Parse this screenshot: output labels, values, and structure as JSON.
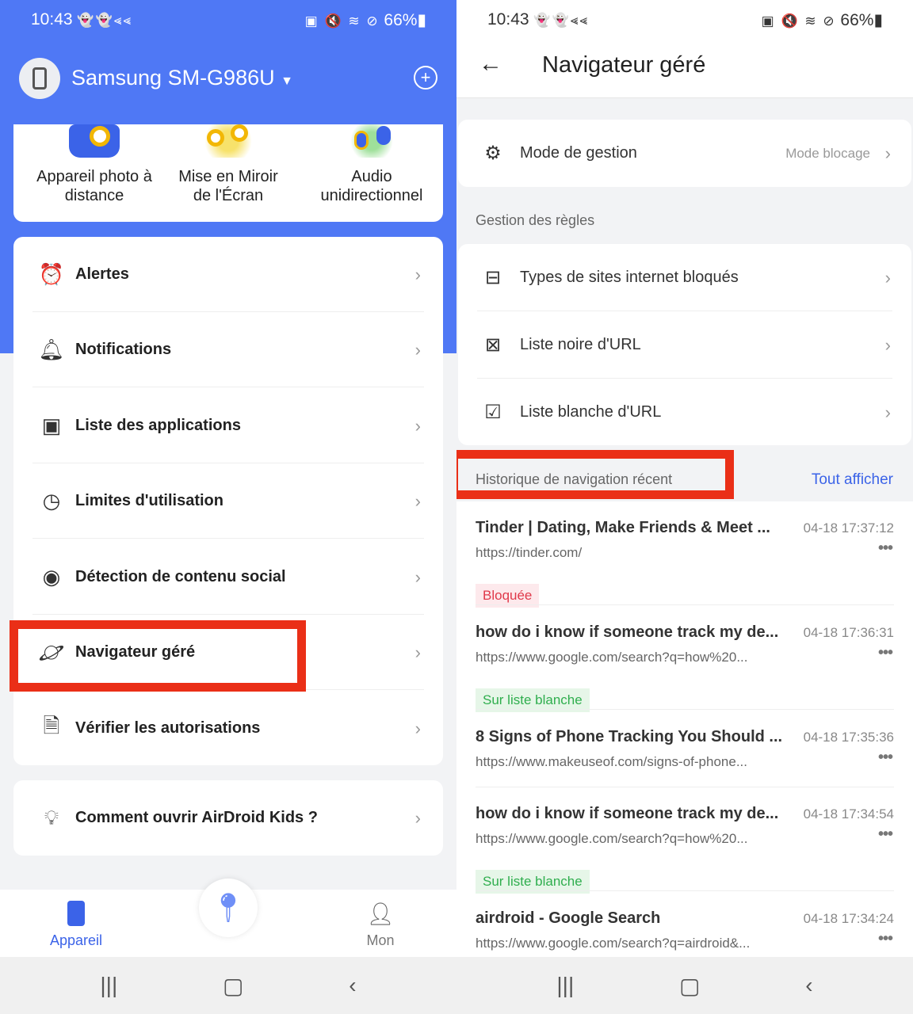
{
  "colors": {
    "brand": "#4f78f5",
    "highlight": "#ea2f17",
    "blocked": "#e0394a",
    "whitelisted": "#2fae4e"
  },
  "status": {
    "time": "10:43",
    "battery": "66%",
    "left_icons": "👻👻⪡⪡",
    "right_icons": "▣ 🔇 ≋ ⊘"
  },
  "left": {
    "device_name": "Samsung SM-G986U",
    "features": [
      {
        "label": "Appareil photo à distance",
        "icon": "camera-icon"
      },
      {
        "label": "Mise en Miroir de l'Écran",
        "icon": "binoculars-icon"
      },
      {
        "label": "Audio unidirectionnel",
        "icon": "headphones-icon"
      }
    ],
    "menu": [
      {
        "label": "Alertes",
        "icon": "alarm-icon"
      },
      {
        "label": "Notifications",
        "icon": "bell-icon"
      },
      {
        "label": "Liste des applications",
        "icon": "apps-grid-icon"
      },
      {
        "label": "Limites d'utilisation",
        "icon": "clock-icon"
      },
      {
        "label": "Détection de contenu social",
        "icon": "eye-icon"
      },
      {
        "label": "Navigateur géré",
        "icon": "planet-icon"
      },
      {
        "label": "Vérifier les autorisations",
        "icon": "doc-search-icon"
      }
    ],
    "help": "Comment ouvrir AirDroid Kids ?",
    "nav": {
      "device": "Appareil",
      "me": "Mon"
    }
  },
  "right": {
    "title": "Navigateur géré",
    "mode_label": "Mode de gestion",
    "mode_value": "Mode blocage",
    "rules_header": "Gestion des règles",
    "rules": [
      {
        "label": "Types de sites internet bloqués",
        "icon": "browser-block-icon"
      },
      {
        "label": "Liste noire d'URL",
        "icon": "clipboard-x-icon"
      },
      {
        "label": "Liste blanche d'URL",
        "icon": "clipboard-check-icon"
      }
    ],
    "history_header": "Historique de navigation récent",
    "show_all": "Tout afficher",
    "history": [
      {
        "title": "Tinder | Dating, Make Friends & Meet ...",
        "date": "04-18 17:37:12",
        "url": "https://tinder.com/",
        "badge": "Bloquée",
        "status": "blocked"
      },
      {
        "title": "how do i know if someone track my de...",
        "date": "04-18 17:36:31",
        "url": "https://www.google.com/search?q=how%20...",
        "badge": "Sur liste blanche",
        "status": "whitelisted"
      },
      {
        "title": "8 Signs of Phone Tracking You Should ...",
        "date": "04-18 17:35:36",
        "url": "https://www.makeuseof.com/signs-of-phone...",
        "badge": "",
        "status": "none"
      },
      {
        "title": "how do i know if someone track my de...",
        "date": "04-18 17:34:54",
        "url": "https://www.google.com/search?q=how%20...",
        "badge": "Sur liste blanche",
        "status": "whitelisted"
      },
      {
        "title": "airdroid - Google Search",
        "date": "04-18 17:34:24",
        "url": "https://www.google.com/search?q=airdroid&...",
        "badge": "",
        "status": "none"
      }
    ]
  }
}
